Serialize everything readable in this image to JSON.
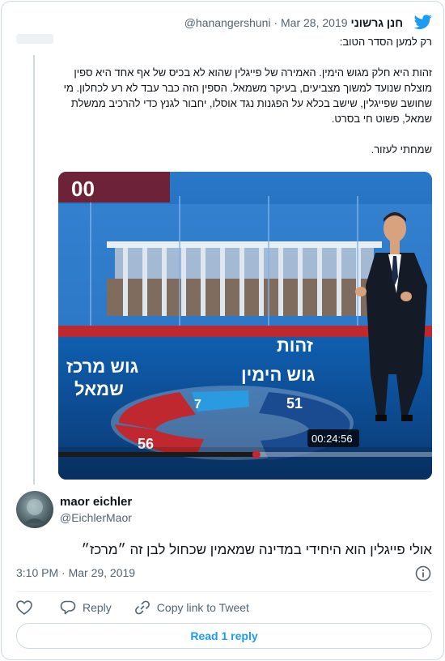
{
  "quoted_tweet": {
    "author_name": "חנן גרשוני",
    "author_handle": "@hanangershuni",
    "separator": "·",
    "date": "Mar 28, 2019",
    "paragraphs": [
      "רק למען הסדר הטוב:",
      "זהות היא חלק מגוש הימין. האמירה של פייגלין שהוא לא בכיס של אף אחד היא ספין מוצלח שנועד למשוך מצביעים, בעיקר משמאל. הספין הזה כבר עבד לא רע לכחלון. מי שחושב שפייגלין, שישב בכלא על הפגנות נגד אוסלו, יחבור לגנץ כדי להרכיב ממשלת שמאל, פשוט חי בסרט.",
      "שמחתי לעזור."
    ],
    "media": {
      "channel_logo": "00",
      "label_party": "זהות",
      "label_right": "גוש הימין",
      "label_left_line1": "גוש מרכז",
      "label_left_line2": "שמאל",
      "num_left": "56",
      "num_right": "51",
      "num_mid": "7",
      "video_time": "00:24:56",
      "video_progress": 0.53,
      "colors": {
        "left_bloc": "#c0282f",
        "right_bloc": "#1a4a8f",
        "studio_blue": "#0e3e7a"
      }
    }
  },
  "reply_tweet": {
    "author_name": "maor eichler",
    "author_handle": "@EichlerMaor",
    "text": "אולי פייגלין הוא היחידי במדינה שמאמין שכחול לבן זה ״מרכז״",
    "timestamp": "3:10 PM · Mar 29, 2019",
    "actions": {
      "reply": "Reply",
      "copy_link": "Copy link to Tweet"
    },
    "read_replies": "Read 1 reply"
  },
  "colors": {
    "accent": "#1d9bf0",
    "text_secondary": "#536471",
    "border": "#cfd9de"
  },
  "icons": [
    "twitter-bird-icon",
    "info-icon",
    "heart-icon",
    "reply-icon",
    "link-icon"
  ]
}
